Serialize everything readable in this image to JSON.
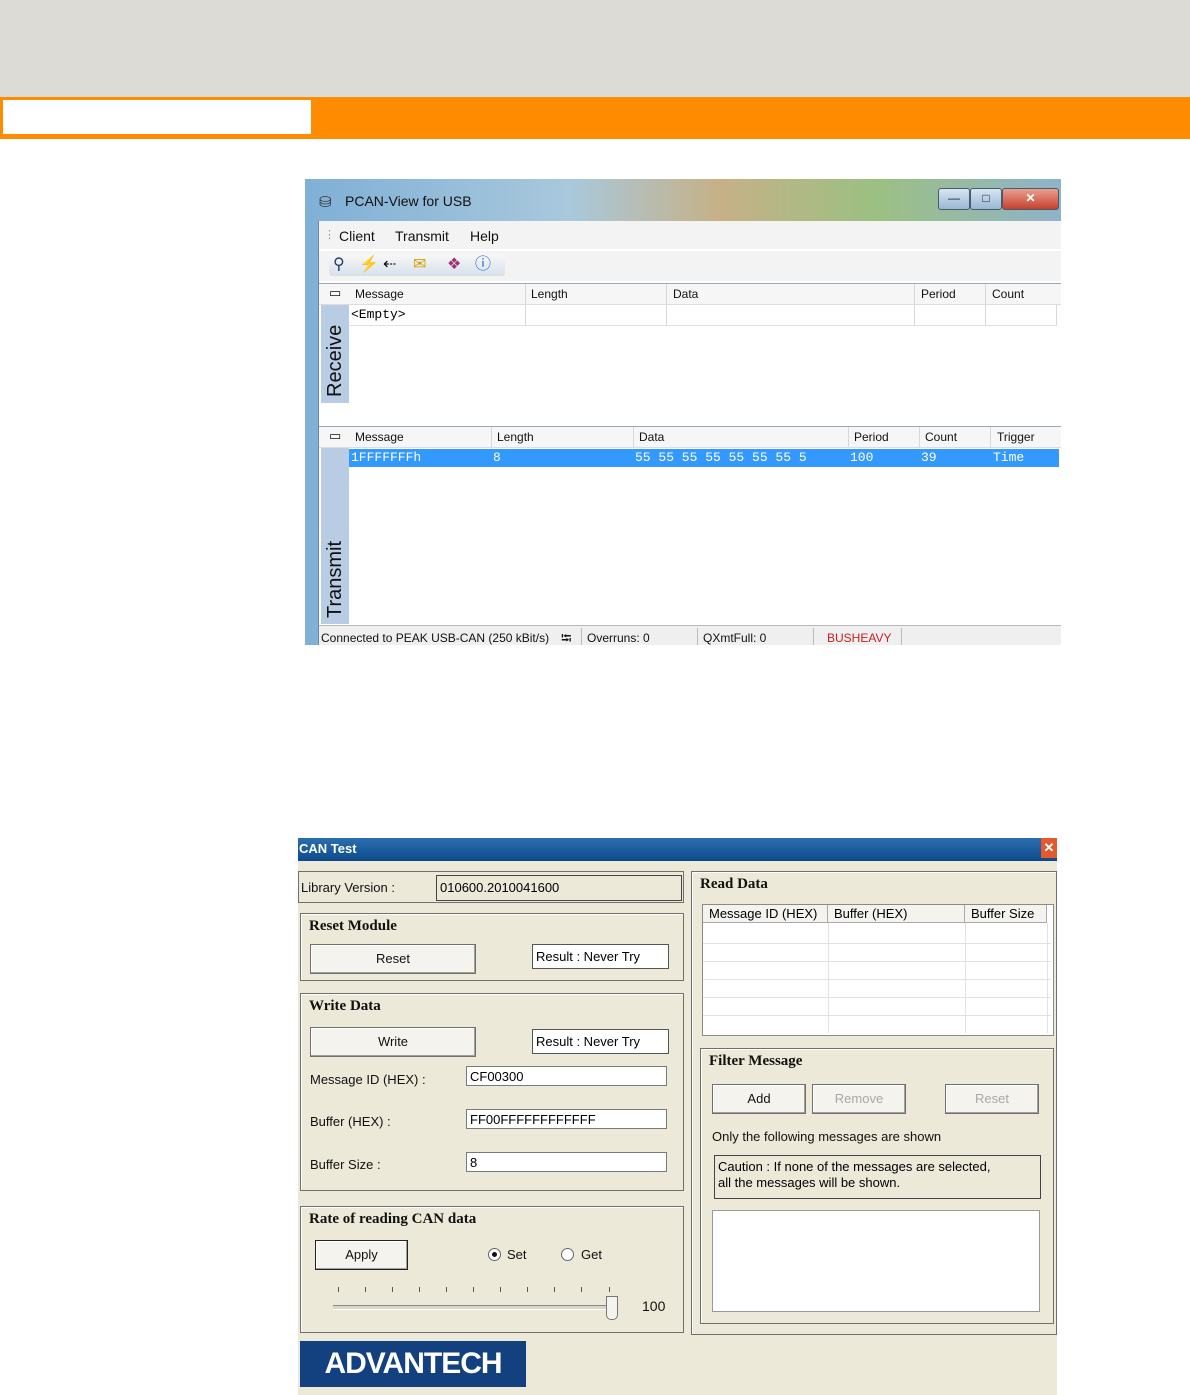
{
  "pcan": {
    "title": "PCAN-View for USB",
    "window_buttons": {
      "minimize": "—",
      "maximize": "□",
      "close": "✕"
    },
    "menu": {
      "client": "Client",
      "transmit": "Transmit",
      "help": "Help"
    },
    "receive": {
      "label": "Receive",
      "columns": [
        "Message",
        "Length",
        "Data",
        "Period",
        "Count"
      ],
      "rows": [
        {
          "message": "<Empty>"
        }
      ]
    },
    "transmit": {
      "label": "Transmit",
      "columns": [
        "Message",
        "Length",
        "Data",
        "Period",
        "Count",
        "Trigger"
      ],
      "rows": [
        {
          "message": "1FFFFFFFh",
          "length": "8",
          "data": "55 55 55 55 55 55 55 5",
          "period": "100",
          "count": "39",
          "trigger": "Time"
        }
      ]
    },
    "status": {
      "connected": "Connected to PEAK USB-CAN (250 kBit/s)",
      "overruns": "Overruns: 0",
      "qxmtfull": "QXmtFull: 0",
      "bus": "BUSHEAVY"
    },
    "colors": {
      "bus_status": "#cc2020",
      "selection": "#3399ff"
    }
  },
  "cantest": {
    "title": "CAN Test",
    "close": "✕",
    "library_version_label": "Library Version :",
    "library_version": "010600.2010041600",
    "reset_module": {
      "title": "Reset Module",
      "button": "Reset",
      "result": "Result : Never Try"
    },
    "write_data": {
      "title": "Write Data",
      "button": "Write",
      "result": "Result : Never Try",
      "msgid_label": "Message ID (HEX) :",
      "msgid": "CF00300",
      "buffer_label": "Buffer (HEX) :",
      "buffer": "FF00FFFFFFFFFFFF",
      "size_label": "Buffer Size :",
      "size": "8"
    },
    "rate": {
      "title": "Rate of reading CAN data",
      "apply": "Apply",
      "set": "Set",
      "get": "Get",
      "selected": "Set",
      "value": "100",
      "slider_level": 1.0
    },
    "read_data": {
      "title": "Read Data",
      "columns": [
        "Message ID (HEX)",
        "Buffer (HEX)",
        "Buffer Size"
      ]
    },
    "filter": {
      "title": "Filter Message",
      "add": "Add",
      "remove": "Remove",
      "reset": "Reset",
      "info": "Only the following messages are shown",
      "caution_line1": "Caution : If none of the messages are selected,",
      "caution_line2": "all the messages will be shown."
    },
    "logo": "ADVANTECH"
  }
}
